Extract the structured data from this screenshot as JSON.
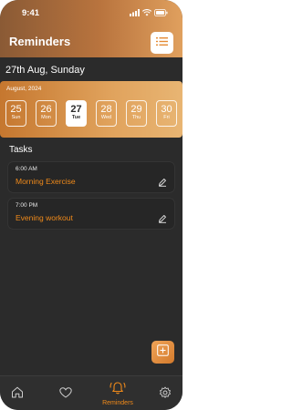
{
  "status": {
    "time": "9:41"
  },
  "header": {
    "title": "Reminders",
    "menu_icon": "list-icon"
  },
  "date_heading": "27th Aug, Sunday",
  "calendar": {
    "month": "August, 2024",
    "days": [
      {
        "num": "25",
        "dow": "Sun",
        "selected": false
      },
      {
        "num": "26",
        "dow": "Mon",
        "selected": false
      },
      {
        "num": "27",
        "dow": "Tue",
        "selected": true
      },
      {
        "num": "28",
        "dow": "Wed",
        "selected": false
      },
      {
        "num": "29",
        "dow": "Thu",
        "selected": false
      },
      {
        "num": "30",
        "dow": "Fri",
        "selected": false
      }
    ]
  },
  "tasks_heading": "Tasks",
  "tasks": [
    {
      "time": "6:00 AM",
      "name": "Morning Exercise"
    },
    {
      "time": "7:00 PM",
      "name": "Evening workout"
    }
  ],
  "nav": {
    "items": [
      {
        "icon": "home-icon",
        "label": ""
      },
      {
        "icon": "heart-icon",
        "label": ""
      },
      {
        "icon": "alarm-icon",
        "label": "Reminders",
        "active": true
      },
      {
        "icon": "gear-icon",
        "label": ""
      }
    ]
  },
  "colors": {
    "accent": "#f08a1a",
    "background": "#2b2b2b"
  }
}
